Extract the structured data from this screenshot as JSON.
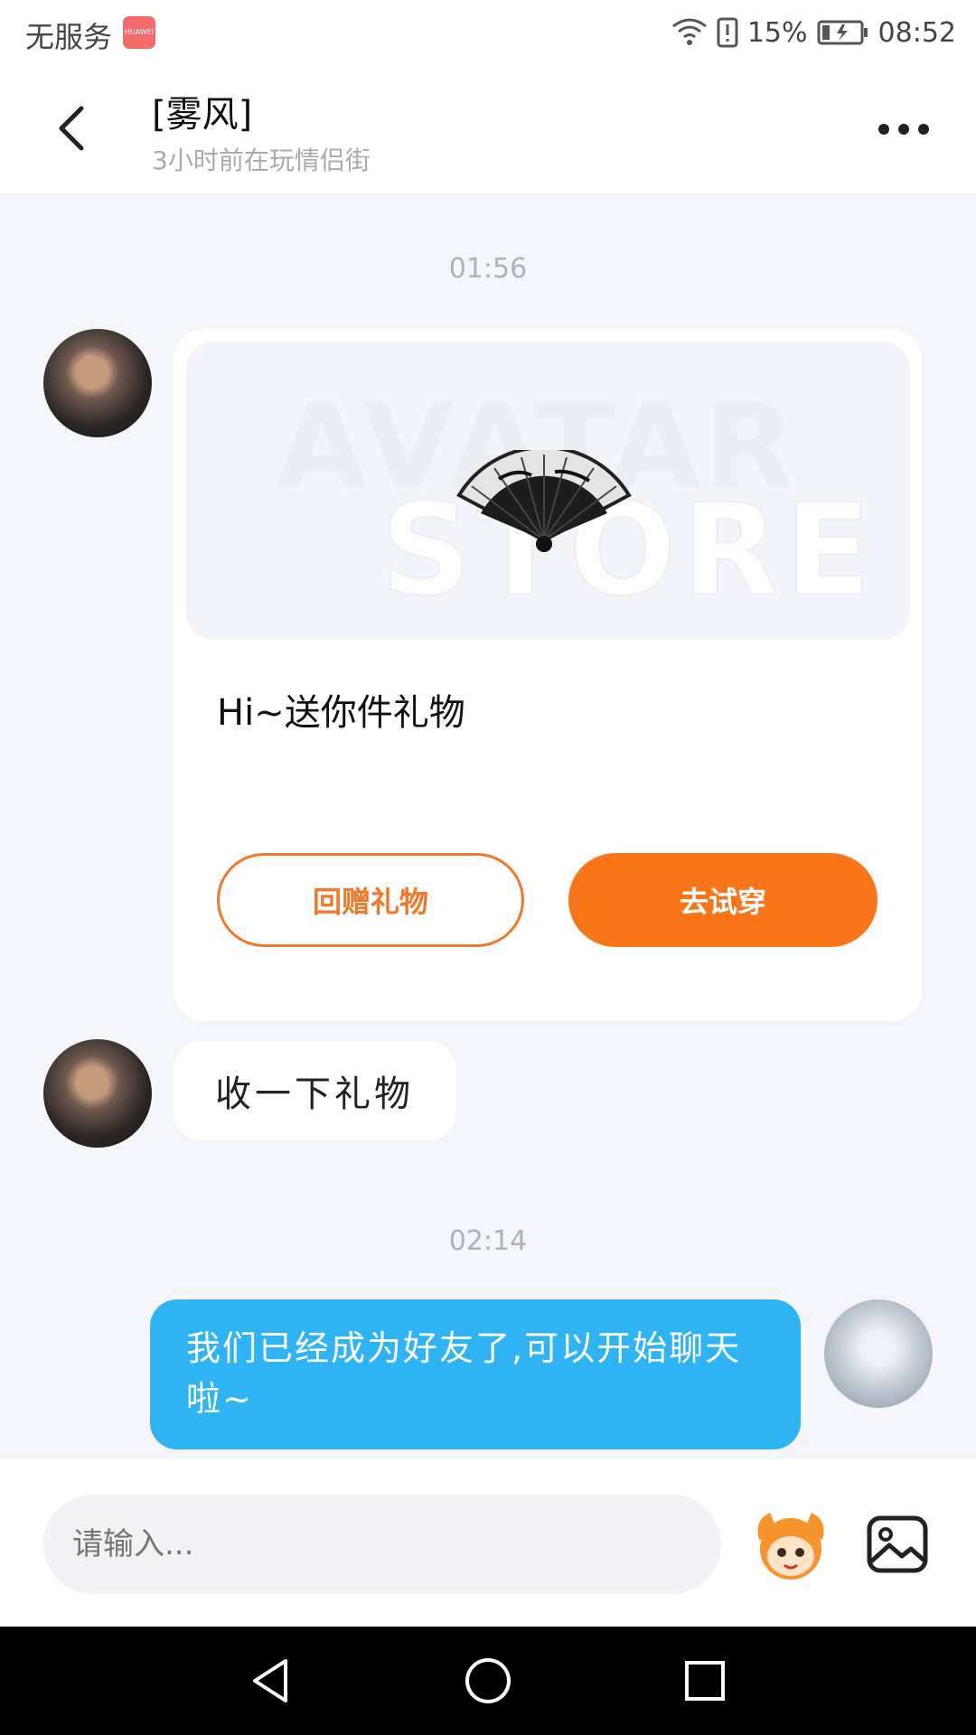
{
  "status_bar": {
    "carrier": "无服务",
    "store_badge": "HUAWEI",
    "battery": "15%",
    "time": "08:52"
  },
  "header": {
    "title": "[雾风]",
    "subtitle": "3小时前在玩情侣街"
  },
  "chat": {
    "messages": [
      {
        "type": "timestamp",
        "text": "01:56"
      },
      {
        "type": "gift_card",
        "side": "incoming",
        "watermark_line1": "AVATAR",
        "watermark_line2": "STORE",
        "text": "Hi~送你件礼物",
        "button_return": "回赠礼物",
        "button_try": "去试穿"
      },
      {
        "type": "text",
        "side": "incoming",
        "text": "收一下礼物"
      },
      {
        "type": "timestamp",
        "text": "02:14"
      },
      {
        "type": "text",
        "side": "outgoing",
        "text": "我们已经成为好友了,可以开始聊天啦~"
      }
    ]
  },
  "input": {
    "placeholder": "请输入..."
  },
  "icons": {
    "back": "back-arrow-icon",
    "more": "more-icon",
    "sticker": "sticker-mascot-icon",
    "image": "image-icon",
    "nav_back": "nav-back-icon",
    "nav_home": "nav-home-icon",
    "nav_recent": "nav-recent-icon"
  },
  "colors": {
    "accent_orange": "#fa7418",
    "outgoing_bubble": "#2eb4f4",
    "background": "#f4f5fa"
  }
}
